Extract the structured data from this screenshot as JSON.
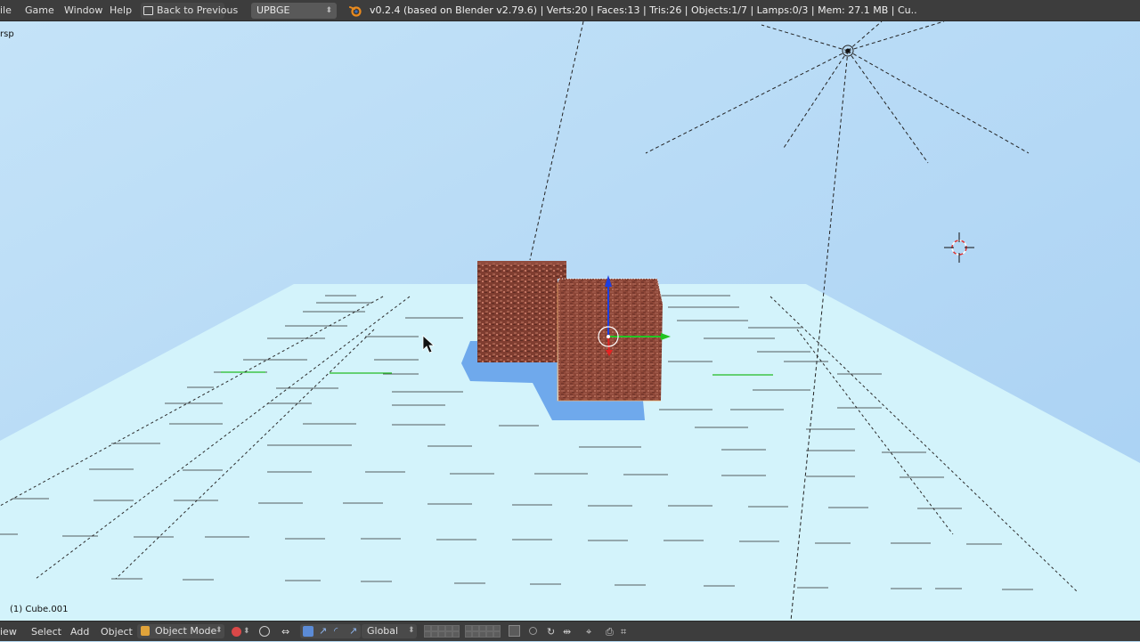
{
  "topbar": {
    "menus": [
      "ile",
      "Game",
      "Window",
      "Help"
    ],
    "back_label": "Back to Previous",
    "engine": "UPBGE",
    "stats": "v0.2.4 (based on Blender v2.79.6) | Verts:20 | Faces:13 | Tris:26 | Objects:1/7 | Lamps:0/3 | Mem: 27.1 MB | Cu.."
  },
  "viewport": {
    "view_label": "rsp",
    "object_label": "(1) Cube.001",
    "colors": {
      "sky": "#b9dcf5",
      "ground": "#d3f3fb",
      "shadow": "#6fa9ec",
      "axis_x": "#e52222",
      "axis_y": "#21c421",
      "axis_z": "#1e3fe0"
    }
  },
  "bottombar": {
    "menus": [
      "iew",
      "Select",
      "Add",
      "Object"
    ],
    "mode": "Object Mode",
    "orientation": "Global",
    "icons": [
      "viewport-shading-icon",
      "pivot-icon",
      "manipulator-icon",
      "translate-icon",
      "rotate-icon",
      "scale-icon",
      "layers-icon",
      "render-layer-icon",
      "proportional-edit-icon",
      "snap-icon",
      "snap-target-icon",
      "render-icon"
    ]
  }
}
